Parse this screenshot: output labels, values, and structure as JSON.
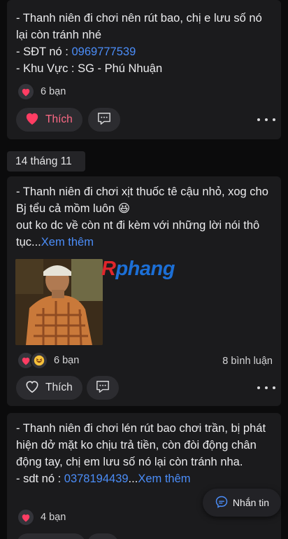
{
  "posts": [
    {
      "lines": [
        "- Thanh niên đi chơi nên rút bao, chị e lưu số nó lại còn tránh nhé",
        "- SĐT nó : ",
        "- Khu Vực : SG - Phú Nhuận"
      ],
      "phone": "0969777539",
      "reaction_count": "6 bạn",
      "like_label": "Thích",
      "liked": true
    },
    {
      "date": "14 tháng 11",
      "line1": "- Thanh niên đi chơi xịt thuốc tê cậu nhỏ, xog cho Bj tểu cả mồm luôn",
      "emoji": "😆",
      "line2": "out ko dc về còn nt đi kèm với những lời nói thô tục...",
      "see_more": "Xem thêm",
      "watermark_r": "R",
      "watermark_rest": "phang",
      "reaction_count": "6 bạn",
      "comment_count": "8 bình luận",
      "like_label": "Thích",
      "liked": false
    },
    {
      "line1": "- Thanh niên đi chơi lén rút bao chơi trần, bị phát hiện dở mặt ko chịu trả tiền, còn đòi động chân động tay, chị em lưu số nó lại còn tránh nha.",
      "line2_prefix": "- sdt nó : ",
      "phone": "0378194439",
      "ellipsis": "...",
      "see_more": "Xem thêm",
      "reaction_count": "4 bạn"
    }
  ],
  "message_button": {
    "label": "Nhắn tin"
  },
  "icons": {
    "heart": "heart-icon",
    "laugh": "laugh-emoji-icon",
    "comment": "comment-icon",
    "more": "more-icon",
    "messenger": "messenger-icon"
  },
  "colors": {
    "link": "#4b8df8",
    "liked": "#ff3d63",
    "card": "#1b1b1d"
  }
}
